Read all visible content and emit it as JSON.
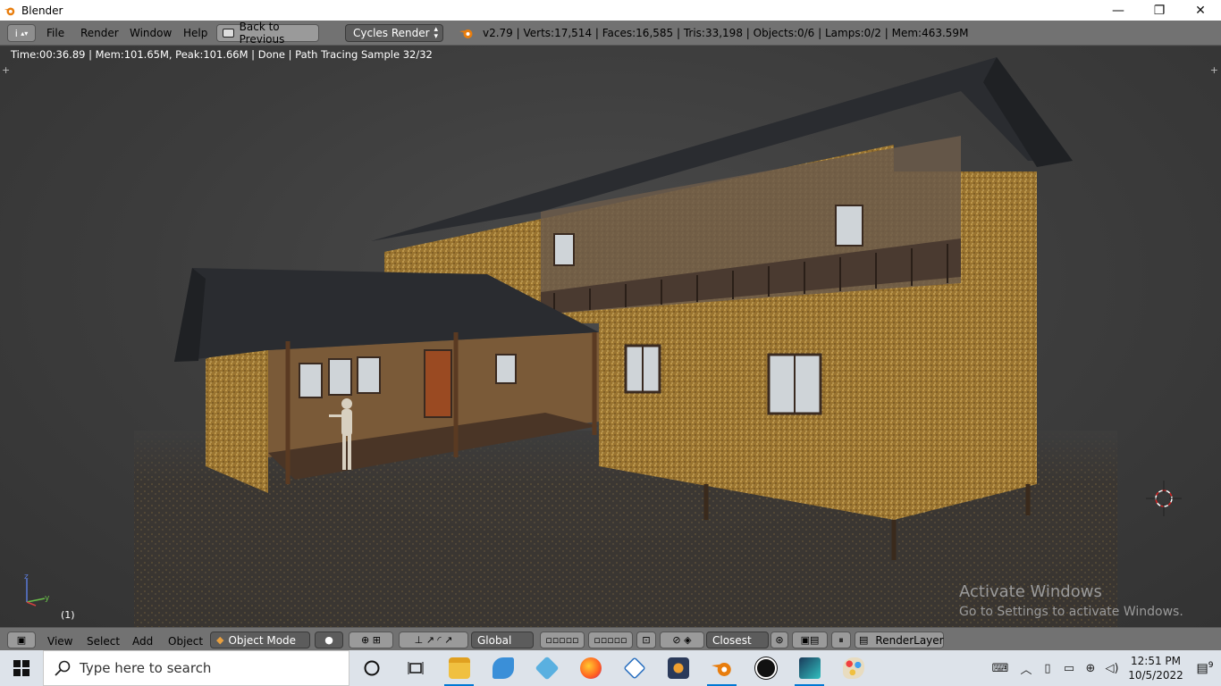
{
  "window": {
    "title": "Blender",
    "minimize": "—",
    "restore": "❐",
    "close": "✕"
  },
  "info_header": {
    "editor_icon": "i",
    "menus": [
      "File",
      "Render",
      "Window",
      "Help"
    ],
    "back_button": "Back to Previous",
    "render_engine": "Cycles Render",
    "stats": "v2.79 | Verts:17,514 | Faces:16,585 | Tris:33,198 | Objects:0/6 | Lamps:0/2 | Mem:463.59M"
  },
  "viewport": {
    "render_status": "Time:00:36.89 | Mem:101.65M, Peak:101.66M | Done | Path Tracing Sample 32/32",
    "frame_indicator": "(1)",
    "axis_z": "z",
    "axis_y": "y",
    "activation_title": "Activate Windows",
    "activation_subtitle": "Go to Settings to activate Windows."
  },
  "view3d_header": {
    "menus": [
      "View",
      "Select",
      "Add",
      "Object"
    ],
    "mode": "Object Mode",
    "orientation": "Global",
    "snap_target": "Closest",
    "render_layer": "RenderLayer"
  },
  "taskbar": {
    "search_placeholder": "Type here to search",
    "apps": [
      "cortana-icon",
      "task-view-icon",
      "file-explorer-icon",
      "dolphin-icon",
      "puzzle-app-icon",
      "firefox-icon",
      "network-app-icon",
      "media-app-icon",
      "blender-icon",
      "unreal-icon",
      "game-app-icon",
      "paint-icon"
    ],
    "time": "12:51 PM",
    "date": "10/5/2022",
    "notification_count": "9"
  },
  "colors": {
    "accent": "#0078d4",
    "header_gray": "#727272",
    "viewport_bg": "#3d3d3d",
    "wall": "#b08a3a",
    "roof": "#2a2c30"
  }
}
